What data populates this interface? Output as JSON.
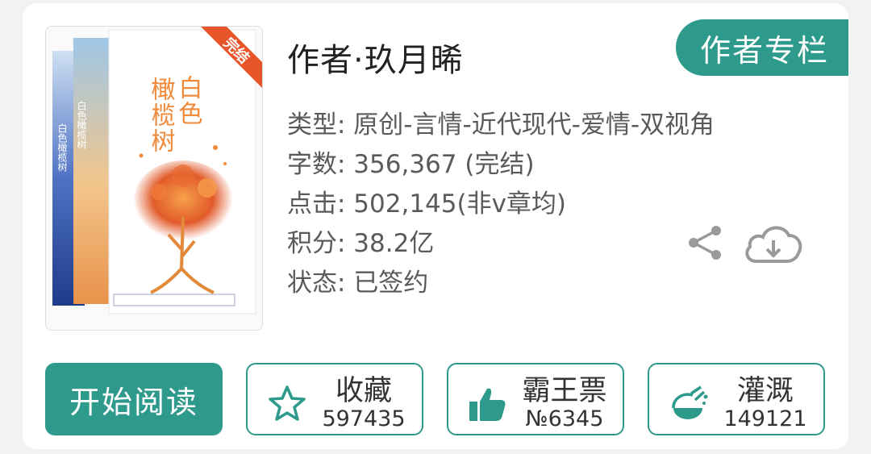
{
  "book": {
    "cover_badge": "完结",
    "cover_title": "白色橄榄树",
    "cover_author": "玖月晞",
    "author_line": "作者·玖月晞",
    "author_column_label": "作者专栏",
    "meta": {
      "genre": "类型: 原创-言情-近代现代-爱情-双视角",
      "word_count": "字数: 356,367 (完结)",
      "clicks": "点击: 502,145(非v章均)",
      "score": "积分: 38.2亿",
      "status": "状态: 已签约"
    }
  },
  "actions": {
    "read_label": "开始阅读",
    "favorite": {
      "label": "收藏",
      "count": "597435"
    },
    "vote": {
      "label": "霸王票",
      "count": "№6345"
    },
    "nutrient": {
      "label": "灌溉",
      "count": "149121"
    }
  },
  "icons": {
    "share": "share-icon",
    "download": "cloud-download-icon",
    "favorite": "star-icon",
    "vote": "thumbs-up-icon",
    "nutrient": "watering-flask-icon"
  },
  "colors": {
    "accent": "#2e9a8b",
    "badge": "#e8552a",
    "text": "#5a5a5a"
  }
}
